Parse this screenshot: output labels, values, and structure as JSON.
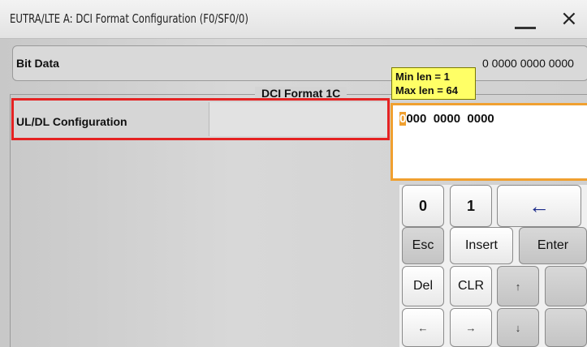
{
  "window": {
    "title": "EUTRA/LTE A: DCI Format Configuration (F0/SF0/0)",
    "minimize_icon": "minimize-icon",
    "close_label": "×"
  },
  "bit_data": {
    "label": "Bit Data",
    "value": "0 0000 0000 0000"
  },
  "group": {
    "title": "DCI Format 1C"
  },
  "row": {
    "label": "UL/DL Configuration",
    "value": ""
  },
  "tooltip": {
    "min": "Min len = 1",
    "max": "Max len = 64"
  },
  "editor": {
    "cursor_char": "0",
    "text_rest": "000  0000  0000"
  },
  "keypad": {
    "k0": "0",
    "k1": "1",
    "backspace": "←",
    "esc": "Esc",
    "insert": "Insert",
    "enter": "Enter",
    "del": "Del",
    "clr": "CLR",
    "up": "↑",
    "left": "←",
    "right": "→",
    "down": "↓"
  },
  "colors": {
    "highlight_border": "#e52222",
    "tooltip_bg": "#ffff66",
    "editor_border": "#f0a030"
  }
}
